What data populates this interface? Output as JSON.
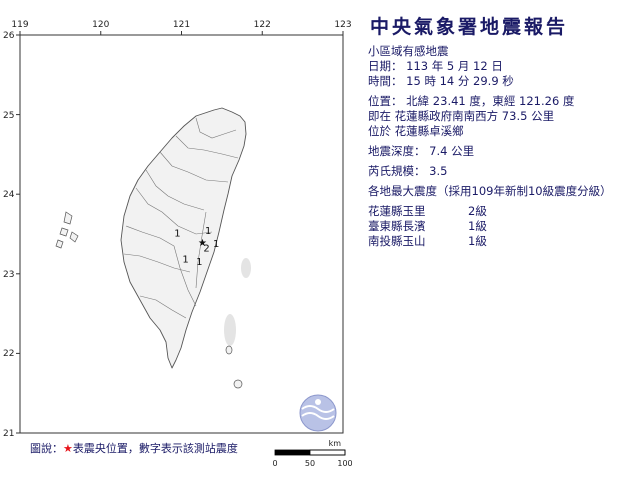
{
  "report": {
    "title": "中央氣象署地震報告",
    "subtitle": "小區域有感地震",
    "date": "日期： 113 年 5 月 12 日",
    "time": "時間： 15 時 14 分 29.9 秒",
    "position": "位置： 北緯 23.41 度，東經 121.26 度",
    "location1": "即在 花蓮縣政府南南西方 73.5 公里",
    "location2": "位於 花蓮縣卓溪鄉",
    "depth": "地震深度： 7.4 公里",
    "magnitude": "芮氏規模： 3.5",
    "intensity_header": "各地最大震度（採用109年新制10級震度分級）",
    "stations": [
      {
        "name": "花蓮縣玉里",
        "level": "2級"
      },
      {
        "name": "臺東縣長濱",
        "level": "1級"
      },
      {
        "name": "南投縣玉山",
        "level": "1級"
      }
    ]
  },
  "map": {
    "lon_ticks": [
      "119",
      "120",
      "121",
      "122",
      "123"
    ],
    "lat_ticks": [
      "26",
      "25",
      "24",
      "23",
      "22",
      "21"
    ],
    "epicenter": {
      "lat": 23.41,
      "lon": 121.26
    },
    "station_marks": [
      {
        "lat": 23.55,
        "lon": 121.33,
        "label": "1"
      },
      {
        "lat": 23.52,
        "lon": 120.95,
        "label": "1"
      },
      {
        "lat": 23.39,
        "lon": 121.43,
        "label": "1"
      },
      {
        "lat": 23.33,
        "lon": 121.31,
        "label": "2"
      },
      {
        "lat": 23.19,
        "lon": 121.05,
        "label": "1"
      },
      {
        "lat": 23.16,
        "lon": 121.22,
        "label": "1"
      }
    ],
    "scale_unit": "km",
    "scale_labels": [
      "0",
      "50",
      "100"
    ],
    "colors": {
      "land": "#f2f2f2",
      "sea": "#ffffff",
      "coast": "#555555",
      "star": "#e8141a",
      "text": "#1a1a66"
    }
  },
  "legend": {
    "prefix": "圖說：",
    "star": "★",
    "text": "表震央位置，數字表示該測站震度"
  }
}
